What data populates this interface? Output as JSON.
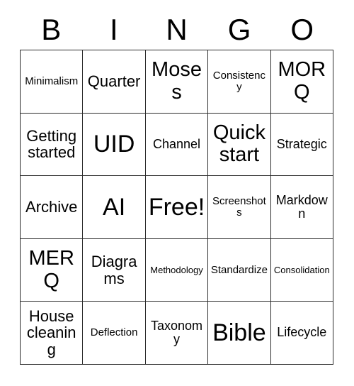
{
  "header": {
    "letters": [
      "B",
      "I",
      "N",
      "G",
      "O"
    ]
  },
  "grid": {
    "columns": 5,
    "rows": 5,
    "border_color": "#2b2b2b",
    "cell_background": "#ffffff",
    "text_color": "#000000",
    "cells": [
      {
        "text": "Minimalism",
        "size": "fs-xs"
      },
      {
        "text": "Quarter",
        "size": "fs-md"
      },
      {
        "text": "Moses",
        "size": "fs-lg"
      },
      {
        "text": "Consistency",
        "size": "fs-xs"
      },
      {
        "text": "MORQ",
        "size": "fs-lg"
      },
      {
        "text": "Getting started",
        "size": "fs-md"
      },
      {
        "text": "UID",
        "size": "fs-xl"
      },
      {
        "text": "Channel",
        "size": "fs-sm"
      },
      {
        "text": "Quick start",
        "size": "fs-lg"
      },
      {
        "text": "Strategic",
        "size": "fs-sm"
      },
      {
        "text": "Archive",
        "size": "fs-md"
      },
      {
        "text": "AI",
        "size": "fs-xl"
      },
      {
        "text": "Free!",
        "size": "fs-xl"
      },
      {
        "text": "Screenshots",
        "size": "fs-xs"
      },
      {
        "text": "Markdown",
        "size": "fs-sm"
      },
      {
        "text": "MERQ",
        "size": "fs-lg"
      },
      {
        "text": "Diagrams",
        "size": "fs-md"
      },
      {
        "text": "Methodology",
        "size": "fs-xxs"
      },
      {
        "text": "Standardize",
        "size": "fs-xs"
      },
      {
        "text": "Consolidation",
        "size": "fs-xxs"
      },
      {
        "text": "House cleaning",
        "size": "fs-md"
      },
      {
        "text": "Deflection",
        "size": "fs-xs"
      },
      {
        "text": "Taxonomy",
        "size": "fs-sm"
      },
      {
        "text": "Bible",
        "size": "fs-xl"
      },
      {
        "text": "Lifecycle",
        "size": "fs-sm"
      }
    ]
  }
}
